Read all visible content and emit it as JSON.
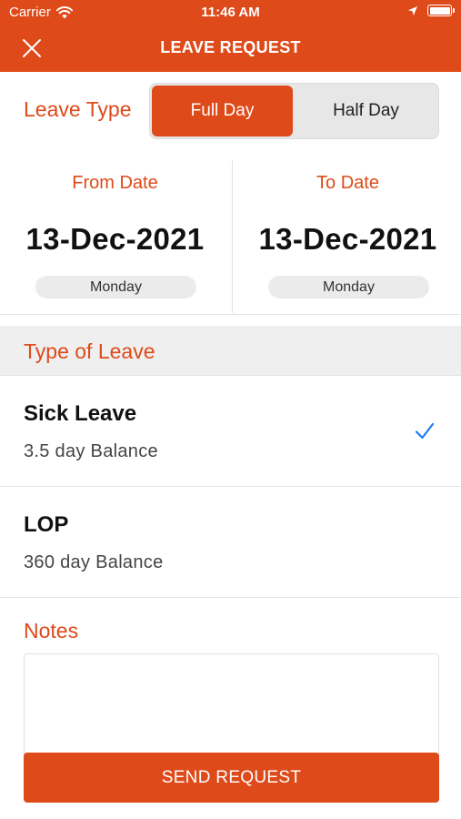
{
  "status_bar": {
    "carrier": "Carrier",
    "time": "11:46 AM"
  },
  "nav": {
    "title": "LEAVE REQUEST",
    "close_icon": "close-icon"
  },
  "leave_type": {
    "label": "Leave Type",
    "options": [
      "Full Day",
      "Half Day"
    ],
    "selected": "Full Day"
  },
  "dates": {
    "from": {
      "label": "From Date",
      "date": "13-Dec-2021",
      "day": "Monday"
    },
    "to": {
      "label": "To Date",
      "date": "13-Dec-2021",
      "day": "Monday"
    }
  },
  "type_of_leave": {
    "title": "Type of Leave",
    "items": [
      {
        "name": "Sick Leave",
        "balance": "3.5 day Balance",
        "selected": true
      },
      {
        "name": "LOP",
        "balance": "360 day Balance",
        "selected": false
      }
    ]
  },
  "notes": {
    "label": "Notes",
    "value": ""
  },
  "send_button": {
    "label": "SEND REQUEST"
  },
  "colors": {
    "accent": "#DE4A1A",
    "check": "#1E7CF2",
    "segment_bg": "#E7E7E7",
    "section_bg": "#EFEFEF"
  }
}
